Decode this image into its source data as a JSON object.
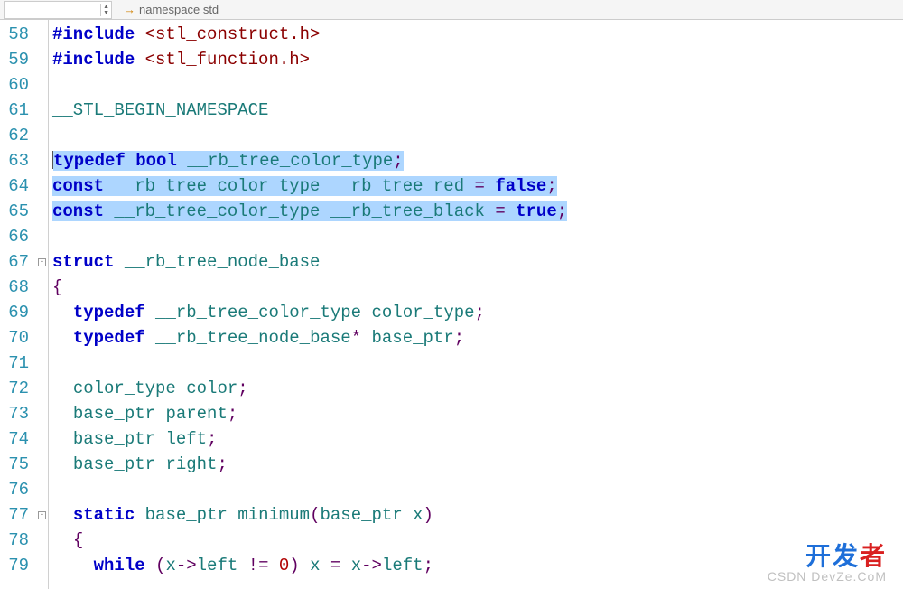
{
  "toolbar": {
    "namespace_label": "namespace std"
  },
  "line_numbers": [
    58,
    59,
    60,
    61,
    62,
    63,
    64,
    65,
    66,
    67,
    68,
    69,
    70,
    71,
    72,
    73,
    74,
    75,
    76,
    77,
    78,
    79
  ],
  "fold_markers": {
    "67": "minus",
    "77": "minus"
  },
  "code": {
    "lines": [
      {
        "segments": [
          {
            "t": "#include",
            "c": "kw"
          },
          {
            "t": " ",
            "c": ""
          },
          {
            "t": "<stl_construct.h>",
            "c": "str"
          }
        ]
      },
      {
        "segments": [
          {
            "t": "#include",
            "c": "kw"
          },
          {
            "t": " ",
            "c": ""
          },
          {
            "t": "<stl_function.h>",
            "c": "str"
          }
        ]
      },
      {
        "segments": []
      },
      {
        "segments": [
          {
            "t": "__STL_BEGIN_NAMESPACE",
            "c": "ident"
          }
        ]
      },
      {
        "segments": []
      },
      {
        "segments": [
          {
            "t": "typedef",
            "c": "kw hl"
          },
          {
            "t": " ",
            "c": "hl"
          },
          {
            "t": "bool",
            "c": "kw hl"
          },
          {
            "t": " ",
            "c": "hl"
          },
          {
            "t": "__rb_tree_color_type",
            "c": "ident hl"
          },
          {
            "t": ";",
            "c": "punct hl"
          }
        ]
      },
      {
        "segments": [
          {
            "t": "const",
            "c": "kw hl"
          },
          {
            "t": " ",
            "c": "hl"
          },
          {
            "t": "__rb_tree_color_type",
            "c": "ident hl"
          },
          {
            "t": " ",
            "c": "hl"
          },
          {
            "t": "__rb_tree_red",
            "c": "ident hl"
          },
          {
            "t": " ",
            "c": "hl"
          },
          {
            "t": "=",
            "c": "punct hl"
          },
          {
            "t": " ",
            "c": "hl"
          },
          {
            "t": "false",
            "c": "kw hl"
          },
          {
            "t": ";",
            "c": "punct hl"
          }
        ]
      },
      {
        "segments": [
          {
            "t": "const",
            "c": "kw hl"
          },
          {
            "t": " ",
            "c": "hl"
          },
          {
            "t": "__rb_tree_color_type",
            "c": "ident hl"
          },
          {
            "t": " ",
            "c": "hl"
          },
          {
            "t": "__rb_tree_black",
            "c": "ident hl"
          },
          {
            "t": " ",
            "c": "hl"
          },
          {
            "t": "=",
            "c": "punct hl"
          },
          {
            "t": " ",
            "c": "hl"
          },
          {
            "t": "true",
            "c": "kw hl"
          },
          {
            "t": ";",
            "c": "punct hl"
          }
        ]
      },
      {
        "segments": []
      },
      {
        "segments": [
          {
            "t": "struct",
            "c": "kw"
          },
          {
            "t": " ",
            "c": ""
          },
          {
            "t": "__rb_tree_node_base",
            "c": "ident"
          }
        ]
      },
      {
        "segments": [
          {
            "t": "{",
            "c": "punct"
          }
        ]
      },
      {
        "segments": [
          {
            "t": "  ",
            "c": ""
          },
          {
            "t": "typedef",
            "c": "kw"
          },
          {
            "t": " ",
            "c": ""
          },
          {
            "t": "__rb_tree_color_type",
            "c": "ident"
          },
          {
            "t": " ",
            "c": ""
          },
          {
            "t": "color_type",
            "c": "ident"
          },
          {
            "t": ";",
            "c": "punct"
          }
        ]
      },
      {
        "segments": [
          {
            "t": "  ",
            "c": ""
          },
          {
            "t": "typedef",
            "c": "kw"
          },
          {
            "t": " ",
            "c": ""
          },
          {
            "t": "__rb_tree_node_base",
            "c": "ident"
          },
          {
            "t": "*",
            "c": "punct"
          },
          {
            "t": " ",
            "c": ""
          },
          {
            "t": "base_ptr",
            "c": "ident"
          },
          {
            "t": ";",
            "c": "punct"
          }
        ]
      },
      {
        "segments": []
      },
      {
        "segments": [
          {
            "t": "  ",
            "c": ""
          },
          {
            "t": "color_type",
            "c": "ident"
          },
          {
            "t": " ",
            "c": ""
          },
          {
            "t": "color",
            "c": "ident"
          },
          {
            "t": ";",
            "c": "punct"
          }
        ]
      },
      {
        "segments": [
          {
            "t": "  ",
            "c": ""
          },
          {
            "t": "base_ptr",
            "c": "ident"
          },
          {
            "t": " ",
            "c": ""
          },
          {
            "t": "parent",
            "c": "ident"
          },
          {
            "t": ";",
            "c": "punct"
          }
        ]
      },
      {
        "segments": [
          {
            "t": "  ",
            "c": ""
          },
          {
            "t": "base_ptr",
            "c": "ident"
          },
          {
            "t": " ",
            "c": ""
          },
          {
            "t": "left",
            "c": "ident"
          },
          {
            "t": ";",
            "c": "punct"
          }
        ]
      },
      {
        "segments": [
          {
            "t": "  ",
            "c": ""
          },
          {
            "t": "base_ptr",
            "c": "ident"
          },
          {
            "t": " ",
            "c": ""
          },
          {
            "t": "right",
            "c": "ident"
          },
          {
            "t": ";",
            "c": "punct"
          }
        ]
      },
      {
        "segments": []
      },
      {
        "segments": [
          {
            "t": "  ",
            "c": ""
          },
          {
            "t": "static",
            "c": "kw"
          },
          {
            "t": " ",
            "c": ""
          },
          {
            "t": "base_ptr",
            "c": "ident"
          },
          {
            "t": " ",
            "c": ""
          },
          {
            "t": "minimum",
            "c": "ident"
          },
          {
            "t": "(",
            "c": "punct"
          },
          {
            "t": "base_ptr",
            "c": "ident"
          },
          {
            "t": " ",
            "c": ""
          },
          {
            "t": "x",
            "c": "ident"
          },
          {
            "t": ")",
            "c": "punct"
          }
        ]
      },
      {
        "segments": [
          {
            "t": "  ",
            "c": ""
          },
          {
            "t": "{",
            "c": "punct"
          }
        ]
      },
      {
        "segments": [
          {
            "t": "    ",
            "c": ""
          },
          {
            "t": "while",
            "c": "kw"
          },
          {
            "t": " ",
            "c": ""
          },
          {
            "t": "(",
            "c": "punct"
          },
          {
            "t": "x",
            "c": "ident"
          },
          {
            "t": "->",
            "c": "punct"
          },
          {
            "t": "left",
            "c": "ident"
          },
          {
            "t": " ",
            "c": ""
          },
          {
            "t": "!=",
            "c": "punct"
          },
          {
            "t": " ",
            "c": ""
          },
          {
            "t": "0",
            "c": "num"
          },
          {
            "t": ")",
            "c": "punct"
          },
          {
            "t": " ",
            "c": ""
          },
          {
            "t": "x",
            "c": "ident"
          },
          {
            "t": " ",
            "c": ""
          },
          {
            "t": "=",
            "c": "punct"
          },
          {
            "t": " ",
            "c": ""
          },
          {
            "t": "x",
            "c": "ident"
          },
          {
            "t": "->",
            "c": "punct"
          },
          {
            "t": "left",
            "c": "ident"
          },
          {
            "t": ";",
            "c": "punct"
          }
        ]
      }
    ]
  },
  "watermark": {
    "line1a": "开发",
    "line1b": "者",
    "line2": "CSDN DevZe.CoM"
  }
}
